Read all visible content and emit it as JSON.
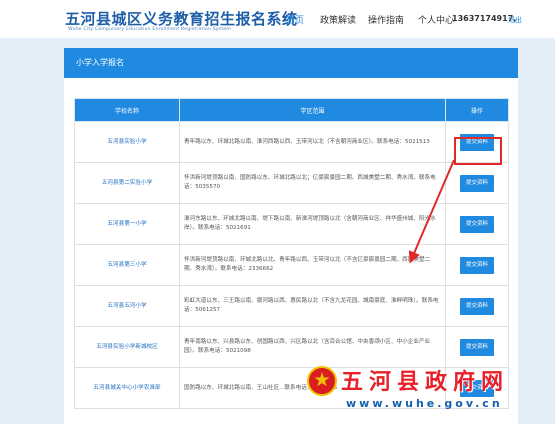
{
  "header": {
    "title": "五河县城区义务教育招生报名系统",
    "subtitle": "Wuhe City Compulsory Education Enrollment Registration System",
    "nav": [
      "首页",
      "政策解读",
      "操作指南",
      "个人中心"
    ],
    "user_id": "13637174917,",
    "logout": "退出",
    "accent_color": "#1f8ae0"
  },
  "panel": {
    "title": "小学入学报名"
  },
  "table": {
    "headers": [
      "学校名称",
      "学区范围",
      "操作"
    ],
    "rows": [
      {
        "name": "五河县实验小学",
        "range": "青年路以东、环城北路以南、淮河西路以西、玉带河以北（不含朝河商业区）。联系电话：5021513",
        "action": "提交资料"
      },
      {
        "name": "五河县第二实验小学",
        "range": "怀洪新河堤顶路以南、国防路以东、环城北路以北；亿豪宸景园二期、西城美墅二期、秀水湾。联系电话：5035570",
        "action": "提交资料"
      },
      {
        "name": "五河县第一小学",
        "range": "淮河东路以东、环城北路以南、堤下路以南、新淮河堤顶路以北（含朝河商业区、祥华盛州城、阳光水岸）。联系电话：5021691",
        "action": "提交资料"
      },
      {
        "name": "五河县第三小学",
        "range": "怀洪新河堤顶路以南、环城北路以北、青年路以西、玉带河以北（不含亿豪宸景园二期、西城美墅二期、秀水湾）。联系电话：2336662",
        "action": "提交资料"
      },
      {
        "name": "五河县五河小学",
        "range": "彩虹大道以东、三王路以南、银河路以西、惠民路以北（不含九龙花园、城南豪庭、淮畔明珠）。联系电话：5061257",
        "action": "提交资料"
      },
      {
        "name": "五河县实验小学新城校区",
        "range": "青年南路以东、兴县路以东、创国路以西、兴区路以北（含百合公馆、中央香颂小区、中小企业产业园）。联系电话：5021098",
        "action": "提交资料"
      },
      {
        "name": "五河县城关中心小学农淮部",
        "range": "国防路以东、环城北路以南、王山社区...联系电话：5040055",
        "action": "提交资料"
      }
    ]
  },
  "watermark": {
    "text": "五河县政府网",
    "url": "www.wuhe.gov.cn"
  }
}
